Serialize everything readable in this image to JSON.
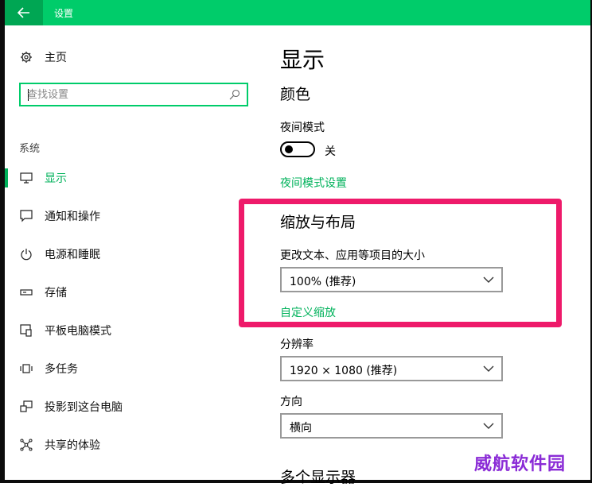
{
  "window": {
    "title": "设置"
  },
  "sidebar": {
    "home_label": "主页",
    "search": {
      "placeholder": "查找设置"
    },
    "section_caption": "系统",
    "items": [
      {
        "label": "显示",
        "icon": "monitor-icon",
        "active": true
      },
      {
        "label": "通知和操作",
        "icon": "notification-icon",
        "active": false
      },
      {
        "label": "电源和睡眠",
        "icon": "power-icon",
        "active": false
      },
      {
        "label": "存储",
        "icon": "storage-icon",
        "active": false
      },
      {
        "label": "平板电脑模式",
        "icon": "tablet-mode-icon",
        "active": false
      },
      {
        "label": "多任务",
        "icon": "multitask-icon",
        "active": false
      },
      {
        "label": "投影到这台电脑",
        "icon": "project-icon",
        "active": false
      },
      {
        "label": "共享的体验",
        "icon": "share-icon",
        "active": false
      }
    ]
  },
  "main": {
    "page_title": "显示",
    "color_section": {
      "heading": "颜色",
      "night_mode_label": "夜间模式",
      "toggle_state": "关",
      "night_mode_settings_link": "夜间模式设置"
    },
    "scale_section": {
      "heading": "缩放与布局",
      "scale_label": "更改文本、应用等项目的大小",
      "scale_value": "100% (推荐)",
      "custom_scale_link": "自定义缩放",
      "resolution_label": "分辨率",
      "resolution_value": "1920 × 1080 (推荐)",
      "orientation_label": "方向",
      "orientation_value": "横向"
    },
    "next_heading_partial": "多个显示器"
  },
  "watermark": "威航软件园",
  "colors": {
    "accent": "#00cc6a",
    "accent_text": "#00b25b",
    "highlight": "#ee1a6a"
  }
}
